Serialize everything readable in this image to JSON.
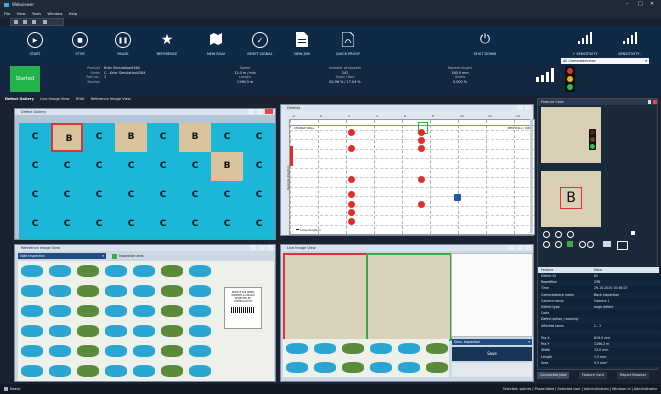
{
  "window": {
    "title": "Webviewer"
  },
  "menu": [
    "File",
    "View",
    "Tools",
    "Window",
    "Help"
  ],
  "toolbar": {
    "buttons": [
      {
        "label": "START",
        "icon": "play-icon"
      },
      {
        "label": "STOP",
        "icon": "stop-icon"
      },
      {
        "label": "PAUSE",
        "icon": "pause-icon"
      },
      {
        "label": "REFERENCE",
        "icon": "star-icon"
      },
      {
        "label": "NEW ROAI",
        "icon": "map-icon"
      },
      {
        "label": "RESET SIGNAL",
        "icon": "check-icon"
      },
      {
        "label": "NEW JOB",
        "icon": "document-icon"
      },
      {
        "label": "QUICK PROOF",
        "icon": "pdf-icon"
      }
    ],
    "shutdown": "SHUT DOWN",
    "sensitivity1": "+ SENSITIVITY",
    "sensitivity2": "SENSITIVITY -",
    "camera_select": "All Cameradevices"
  },
  "status": {
    "state": "Started",
    "product_label": "Product",
    "product": "Krier Simulation0264",
    "order_label": "Order",
    "order": "C - Krier Simulation0264",
    "roll_label": "Roll no.:",
    "roll": "1",
    "section_label": "Section",
    "section": "",
    "speed_label": "Speed",
    "speed": "12.0 m / min",
    "length_label": "Length",
    "length": "1196.3 m",
    "repeats_label": "Number of repeats",
    "repeats": "242",
    "good_bad_label": "Good / Bad",
    "good_bad": "82.96 % / 17.04 %",
    "repeat_length_label": "Repeat length",
    "repeat_length": "160.0 mm",
    "skrew_label": "Skrew",
    "skrew": "0.000 %"
  },
  "tabs": [
    "Defect Gallery",
    "Live Image View",
    "ROAI",
    "Reference Image View"
  ],
  "defect_gallery": {
    "title": "Defect Gallery",
    "tiles": [
      "C",
      "B",
      "C",
      "B",
      "C",
      "B",
      "C",
      "C",
      "C",
      "C",
      "C",
      "C",
      "C",
      "C",
      "B",
      "C",
      "C",
      "C",
      "C",
      "C",
      "C",
      "C",
      "C",
      "C",
      "C",
      "C",
      "C",
      "C",
      "C",
      "C",
      "C",
      "C"
    ]
  },
  "chart_panel": {
    "title": "Defects",
    "x_ticks": [
      "-2",
      "0",
      "2",
      "4",
      "6",
      "8",
      "10",
      "12",
      "14"
    ],
    "top_left_label": "CHANGE ROLL",
    "top_right_label": "NEW ROLL / JOB",
    "y_axis_label": "Running direction",
    "x_axis_label": "Cross direction"
  },
  "reference_panel": {
    "title": "Reference Image View",
    "select": "Gold Inspection",
    "checkbox_label": "Inspection area",
    "ticket_lines": [
      "SERVICE FOR SPEED",
      "ORDERED & UNLOAD",
      "INSPECTED BY:",
      "CONTROLLED BY:"
    ]
  },
  "live_panel": {
    "title": "Live Image View",
    "select": "Sens. Inspection",
    "save": "Save"
  },
  "feature_card": {
    "title": "Feature Card",
    "defect_letter": "B",
    "header_feature": "Feature",
    "header_data": "Data",
    "rows": [
      {
        "k": "Defect ID",
        "v": "61"
      },
      {
        "k": "Repetition",
        "v": "236"
      },
      {
        "k": "Time",
        "v": "29.10.2020 10:46:25"
      },
      {
        "k": "Cameradevice name",
        "v": "Back inspection"
      },
      {
        "k": "Camera name",
        "v": "Camera 1"
      },
      {
        "k": "Defect type",
        "v": "large defect"
      },
      {
        "k": "Code",
        "v": ""
      },
      {
        "k": "Defect action / warning",
        "v": ""
      },
      {
        "k": "Affected lanes",
        "v": "2 - 2"
      },
      {
        "k": "",
        "v": ""
      },
      {
        "k": "Pos X",
        "v": "819.0 mm"
      },
      {
        "k": "Pos Y",
        "v": "1196.2 m"
      },
      {
        "k": "Width",
        "v": "13.0 mm"
      },
      {
        "k": "Length",
        "v": "1.0 mm"
      },
      {
        "k": "Area",
        "v": "9.5 mm²"
      }
    ]
  },
  "right_tabs": [
    "Connected Jobs",
    "Feature Card",
    "Report Browser"
  ],
  "bottom": {
    "ready": "Ready",
    "status_items": "Selected: splines | Phase:Idled | Selected user | Administrators | Window: el | Administrator"
  },
  "colors": {
    "accent": "#0f2a47",
    "started": "#24b34b",
    "selected_red": "#d6353d",
    "selected_green": "#3fa845",
    "tile_c": "#1bb6d8",
    "tile_b": "#d8c39a"
  }
}
